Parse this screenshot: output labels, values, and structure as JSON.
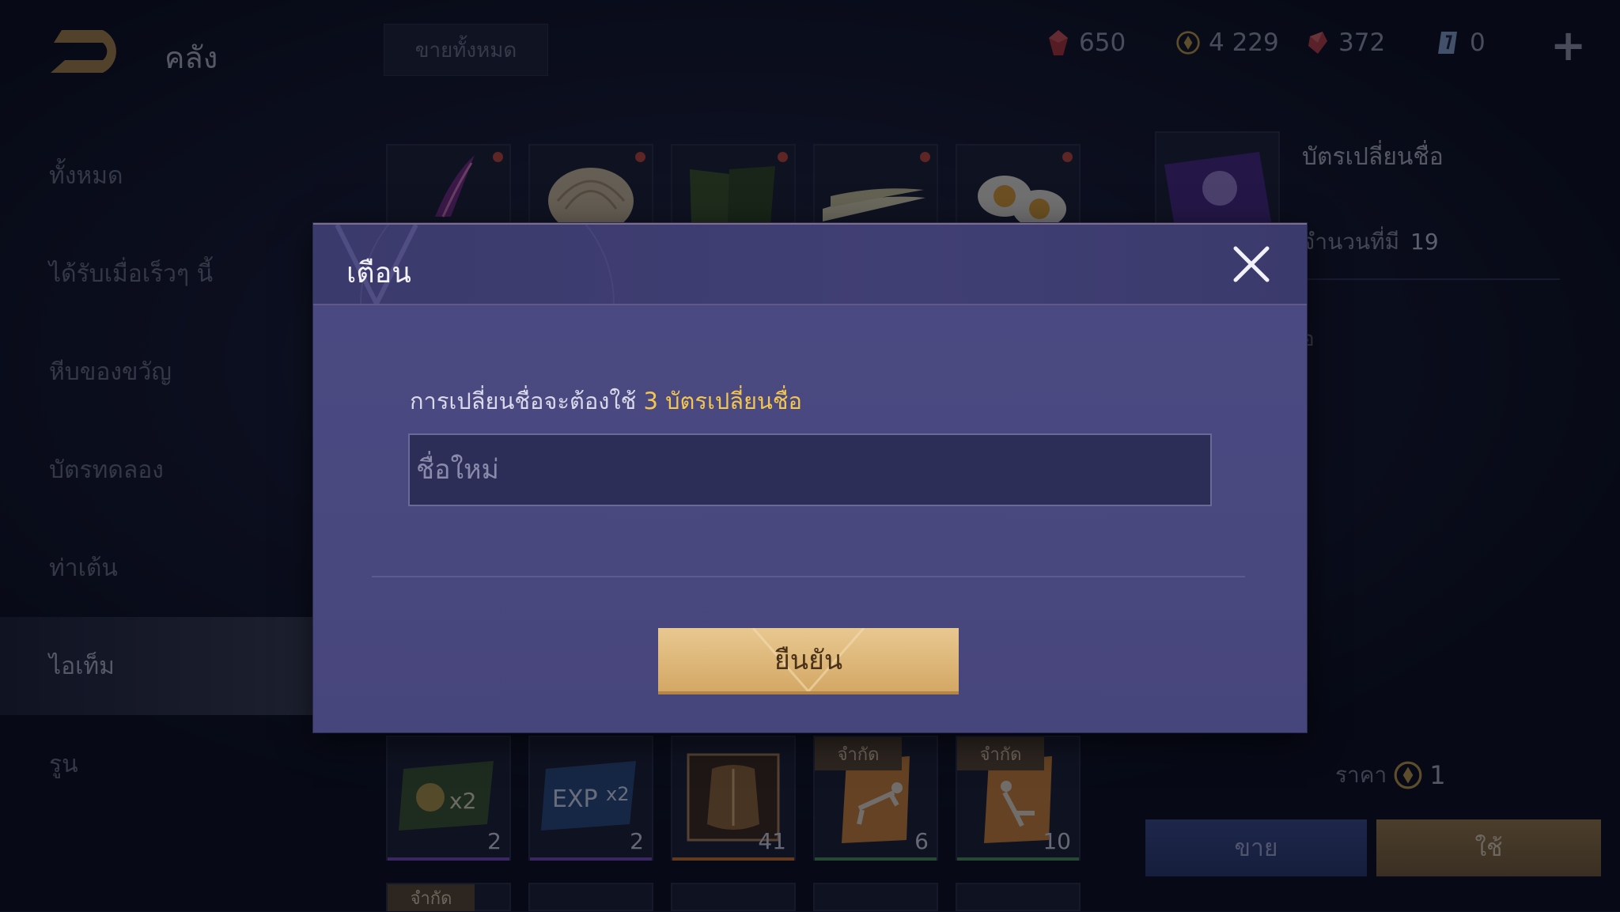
{
  "header": {
    "title": "คลัง",
    "sell_all_label": "ขายทั้งหมด",
    "currencies": [
      {
        "icon": "red-gem-icon",
        "value": "650",
        "color": "#c0393a"
      },
      {
        "icon": "gold-coin-icon",
        "value": "4 229",
        "color": "#c9a24a"
      },
      {
        "icon": "ruby-icon",
        "value": "372",
        "color": "#c84a45"
      },
      {
        "icon": "voucher-icon",
        "value": "0",
        "color": "#8fa8d8"
      }
    ],
    "plus_label": "+"
  },
  "sidebar": {
    "items": [
      {
        "label": "ทั้งหมด",
        "active": false
      },
      {
        "label": "ได้รับเมื่อเร็วๆ นี้",
        "active": false
      },
      {
        "label": "หีบของขวัญ",
        "active": false
      },
      {
        "label": "บัตรทดลอง",
        "active": false
      },
      {
        "label": "ท่าเต้น",
        "active": false
      },
      {
        "label": "ไอเท็ม",
        "active": true
      },
      {
        "label": "รูน",
        "active": false
      }
    ]
  },
  "grid": {
    "top_row": [
      {
        "icon": "purple-weapon-icon",
        "has_dot": true
      },
      {
        "icon": "noodles-icon",
        "has_dot": true
      },
      {
        "icon": "seaweed-icon",
        "has_dot": true
      },
      {
        "icon": "bamboo-shoots-icon",
        "has_dot": true
      },
      {
        "icon": "boiled-egg-icon",
        "has_dot": true
      }
    ],
    "bottom_row": [
      {
        "icon": "gold-x2-card-icon",
        "qty": "2",
        "tag": "",
        "underline": "#7a4cc2"
      },
      {
        "icon": "exp-x2-card-icon",
        "qty": "2",
        "tag": "",
        "underline": "#7a4cc2"
      },
      {
        "icon": "armor-chest-icon",
        "qty": "41",
        "tag": "",
        "underline": "#d6782e"
      },
      {
        "icon": "pushup-card-icon",
        "qty": "6",
        "tag": "จำกัด",
        "underline": "#4f9a5d"
      },
      {
        "icon": "situp-card-icon",
        "qty": "10",
        "tag": "จำกัด",
        "underline": "#4f9a5d"
      }
    ],
    "partial_row_tag": "จำกัด"
  },
  "detail": {
    "icon": "name-change-card-icon",
    "name": "บัตรเปลี่ยนชื่อ",
    "count_label": "จำนวนที่มี",
    "count_value": "19",
    "desc": "อ",
    "price_label": "ราคา",
    "price_value": "1",
    "sell_label": "ขาย",
    "use_label": "ใช้"
  },
  "modal": {
    "title": "เตือน",
    "message_prefix": "การเปลี่ยนชื่อจะต้องใช้",
    "message_highlight": "3 บัตรเปลี่ยนชื่อ",
    "input_placeholder": "ชื่อใหม่",
    "input_value": "",
    "confirm_label": "ยืนยัน",
    "highlight_color": "#f2c64f"
  }
}
